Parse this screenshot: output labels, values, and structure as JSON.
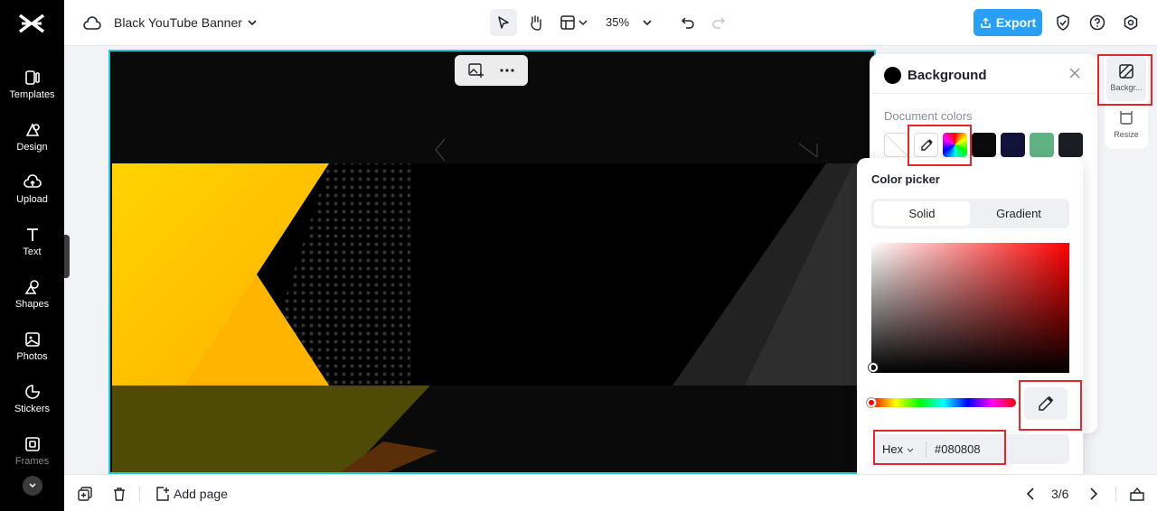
{
  "header": {
    "doc_title": "Black YouTube Banner",
    "zoom": "35%",
    "export_label": "Export"
  },
  "sidebar": {
    "items": [
      {
        "label": "Templates",
        "icon": "templates-icon"
      },
      {
        "label": "Design",
        "icon": "design-icon"
      },
      {
        "label": "Upload",
        "icon": "upload-icon"
      },
      {
        "label": "Text",
        "icon": "text-icon"
      },
      {
        "label": "Shapes",
        "icon": "shapes-icon"
      },
      {
        "label": "Photos",
        "icon": "photos-icon"
      },
      {
        "label": "Stickers",
        "icon": "stickers-icon"
      },
      {
        "label": "Frames",
        "icon": "frames-icon"
      }
    ]
  },
  "right_rail": {
    "background_label": "Backgr...",
    "resize_label": "Resize"
  },
  "background_panel": {
    "title": "Background",
    "doc_colors_label": "Document colors",
    "swatches": [
      "#ffffff",
      "#eyedropper",
      "#rainbow",
      "#0a0a0a",
      "#12123a",
      "#5fb383",
      "#1a1d22"
    ]
  },
  "color_picker": {
    "title": "Color picker",
    "tab_solid": "Solid",
    "tab_gradient": "Gradient",
    "format": "Hex",
    "hex_value": "#080808"
  },
  "bottom": {
    "add_page": "Add page",
    "page_indicator": "3/6"
  },
  "colors": {
    "accent": "#2a9ff6",
    "selection": "#1fc7dc",
    "highlight": "#e3262b",
    "banner_yellow": "#ffd400",
    "banner_olive": "#4f4a05"
  }
}
